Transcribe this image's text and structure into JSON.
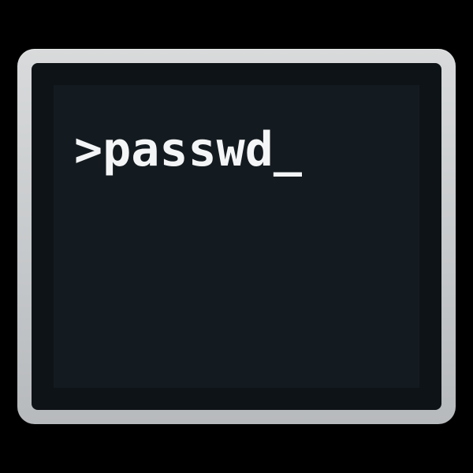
{
  "terminal_icon": {
    "command_text": ">passwd_",
    "colors": {
      "background": "#000000",
      "frame": "#cfd1d3",
      "screen_outer": "#0e1317",
      "screen_inner": "#141b20",
      "text": "#f4f5f6"
    }
  }
}
